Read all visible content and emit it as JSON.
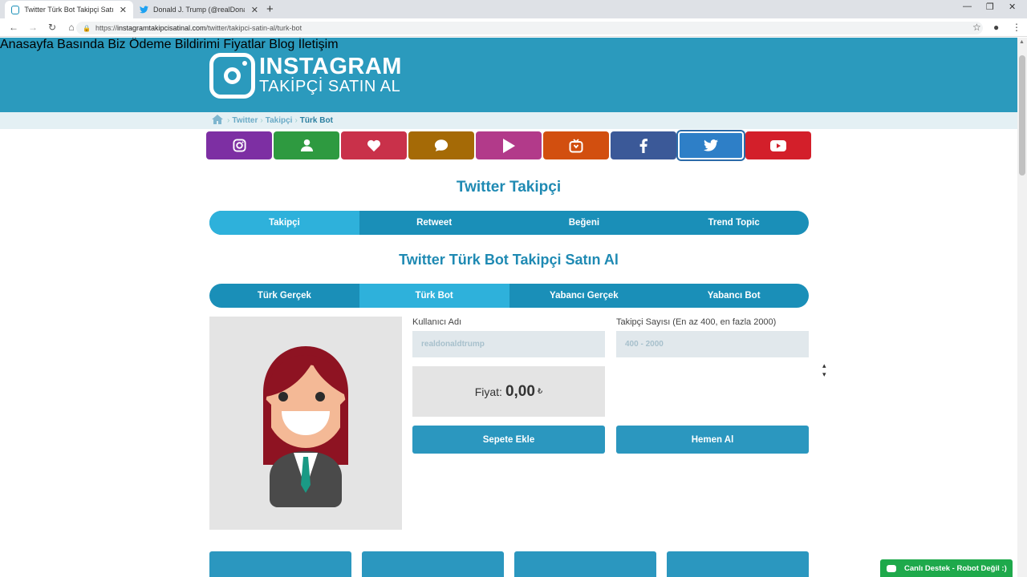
{
  "browser": {
    "tabs": [
      {
        "title": "Twitter Türk Bot Takipçi Satın Al",
        "active": true
      },
      {
        "title": "Donald J. Trump (@realDonaldTr",
        "active": false
      }
    ],
    "url_prefix": "https://",
    "url_domain": "instagramtakipcisatinal.com",
    "url_path": "/twitter/takipci-satin-al/turk-bot"
  },
  "header": {
    "logo_title": "INSTAGRAM",
    "logo_subtitle": "TAKİPÇİ SATIN AL",
    "nav": [
      "Anasayfa",
      "Basında Biz",
      "Ödeme Bildirimi",
      "Fiyatlar",
      "Blog",
      "İletişim"
    ]
  },
  "breadcrumb": [
    "Twitter",
    "Takipçi",
    "Türk Bot"
  ],
  "services": [
    {
      "icon": "instagram-icon",
      "color": "#7d2fa3"
    },
    {
      "icon": "user-icon",
      "color": "#2e9a40"
    },
    {
      "icon": "heart-icon",
      "color": "#c9314a"
    },
    {
      "icon": "comment-icon",
      "color": "#a56a06"
    },
    {
      "icon": "play-icon",
      "color": "#b23a8a"
    },
    {
      "icon": "igtv-icon",
      "color": "#d24f0f"
    },
    {
      "icon": "facebook-icon",
      "color": "#3b5998"
    },
    {
      "icon": "twitter-icon",
      "color": "#2e7fc7"
    },
    {
      "icon": "youtube-icon",
      "color": "#d31f2a"
    }
  ],
  "section_title": "Twitter Takipçi",
  "type_tabs": [
    "Takipçi",
    "Retweet",
    "Beğeni",
    "Trend Topic"
  ],
  "product_title": "Twitter Türk Bot Takipçi Satın Al",
  "quality_tabs": [
    "Türk Gerçek",
    "Türk Bot",
    "Yabancı Gerçek",
    "Yabancı Bot"
  ],
  "form": {
    "username_label": "Kullanıcı Adı",
    "username_placeholder": "realdonaldtrump",
    "count_label": "Takipçi Sayısı (En az 400, en fazla 2000)",
    "count_placeholder": "400 - 2000",
    "price_label": "Fiyat:",
    "price_value": "0,00",
    "currency": "₺",
    "add_to_cart": "Sepete Ekle",
    "buy_now": "Hemen Al"
  },
  "chat": {
    "label": "Canlı Destek - Robot Değil :)"
  }
}
